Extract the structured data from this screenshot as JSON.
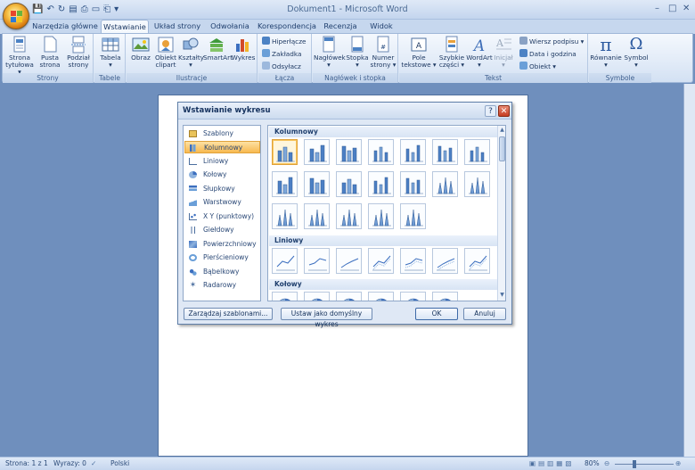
{
  "window": {
    "title": "Dokument1 - Microsoft Word",
    "qat_icons": [
      "save-icon",
      "undo-icon",
      "redo-icon",
      "new-doc-icon",
      "print-preview-icon",
      "open-icon",
      "print-icon",
      "customize-icon"
    ],
    "controls": {
      "minimize": "–",
      "maximize": "□",
      "close": "✕"
    }
  },
  "tabs": [
    "Narzędzia główne",
    "Wstawianie",
    "Układ strony",
    "Odwołania",
    "Korespondencja",
    "Recenzja",
    "Widok"
  ],
  "active_tab": "Wstawianie",
  "ribbon": {
    "groups": {
      "strony": "Strony",
      "tabele": "Tabele",
      "ilustracje": "Ilustracje",
      "lacza": "Łącza",
      "naglowek": "Nagłówek i stopka",
      "tekst": "Tekst",
      "symbole": "Symbole"
    },
    "strona_tytulowa": [
      "Strona",
      "tytułowa ▾"
    ],
    "pusta_strona": [
      "Pusta",
      "strona"
    ],
    "podzial_strony": [
      "Podział",
      "strony"
    ],
    "tabela": [
      "Tabela",
      "▾"
    ],
    "obraz": "Obraz",
    "obiekt_clipart": [
      "Obiekt",
      "clipart"
    ],
    "ksztalty": [
      "Kształty",
      "▾"
    ],
    "smartart": "SmartArt",
    "wykres": "Wykres",
    "hiperlacze": "Hiperłącze",
    "zakladka": "Zakładka",
    "odsylacz": "Odsyłacz",
    "naglowek_btn": [
      "Nagłówek",
      "▾"
    ],
    "stopka": [
      "Stopka",
      "▾"
    ],
    "numer_strony": [
      "Numer",
      "strony ▾"
    ],
    "pole_tekstowe": [
      "Pole",
      "tekstowe ▾"
    ],
    "szybkie_czesci": [
      "Szybkie",
      "części ▾"
    ],
    "wordart": [
      "WordArt",
      "▾"
    ],
    "inicjal": [
      "Inicjał",
      "▾"
    ],
    "wiersz_podpisu": "Wiersz podpisu ▾",
    "data_i_godzina": "Data i godzina",
    "obiekt": "Obiekt ▾",
    "rownanie": [
      "Równanie",
      "▾"
    ],
    "symbol": [
      "Symbol",
      "▾"
    ],
    "pi_glyph": "π",
    "omega_glyph": "Ω"
  },
  "dialog": {
    "title": "Wstawianie wykresu",
    "help": "?",
    "close": "✕",
    "categories": [
      "Szablony",
      "Kolumnowy",
      "Liniowy",
      "Kołowy",
      "Słupkowy",
      "Warstwowy",
      "X Y (punktowy)",
      "Giełdowy",
      "Powierzchniowy",
      "Pierścieniowy",
      "Bąbelkowy",
      "Radarowy"
    ],
    "selected_category": "Kolumnowy",
    "sections": [
      "Kolumnowy",
      "Liniowy",
      "Kołowy"
    ],
    "buttons": {
      "manage_templates": "Zarządzaj szablonami...",
      "set_default": "Ustaw jako domyślny wykres",
      "ok": "OK",
      "cancel": "Anuluj"
    }
  },
  "status": {
    "page": "Strona: 1 z 1",
    "words": "Wyrazy: 0",
    "language": "Polski",
    "zoom": "80%"
  },
  "colors": {
    "accent": "#f8b94f",
    "ribbon": "#e3ecf8",
    "background": "#6f8fbd"
  }
}
